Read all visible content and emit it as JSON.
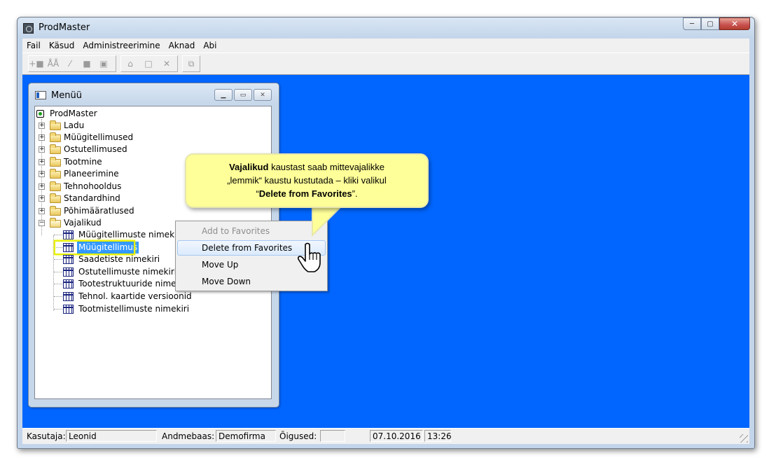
{
  "window": {
    "title": "ProdMaster",
    "btn_min": "─",
    "btn_max": "▢",
    "btn_close": "✕"
  },
  "menubar": [
    "Fail",
    "Käsud",
    "Administreerimine",
    "Aknad",
    "Abi"
  ],
  "menu_window": {
    "title": "Menüü",
    "tree": {
      "root": "ProdMaster",
      "folders": [
        "Ladu",
        "Müügitellimused",
        "Ostutellimused",
        "Tootmine",
        "Planeerimine",
        "Tehnohooldus",
        "Standardhind",
        "Põhimääratlused",
        "Vajalikud"
      ],
      "favorites": [
        "Müügitellimuste nimekiri",
        "Müügitellimus",
        "Saadetiste nimekiri",
        "Ostutellimuste nimekiri",
        "Tootestruktuuride nimekiri",
        "Tehnol. kaartide versioonid",
        "Tootmistellimuste nimekiri"
      ],
      "selected": "Müügitellimus"
    }
  },
  "context_menu": {
    "items": [
      {
        "label": "Add to Favorites",
        "state": "disabled"
      },
      {
        "label": "Delete from Favorites",
        "state": "hover"
      },
      {
        "label": "Move Up",
        "state": "normal"
      },
      {
        "label": "Move Down",
        "state": "normal"
      }
    ]
  },
  "callout": {
    "bold1": "Vajalikud",
    "text1": " kaustast saab mittevajalikke",
    "text2": "„lemmik“ kaustu  kustutada – kliki valikul",
    "quote_open": "“",
    "bold2": "Delete from Favorites",
    "quote_close": "”."
  },
  "statusbar": {
    "user_label": "Kasutaja:",
    "user_value": "Leonid",
    "db_label": "Andmebaas:",
    "db_value": "Demofirma",
    "rights_label": "Õigused:",
    "rights_value": "",
    "date": "07.10.2016",
    "time": "13:26"
  },
  "colors": {
    "desktop": "#0066ff",
    "callout": "#ffff99",
    "selection": "#3399ff",
    "highlight_box": "#e7f000"
  }
}
